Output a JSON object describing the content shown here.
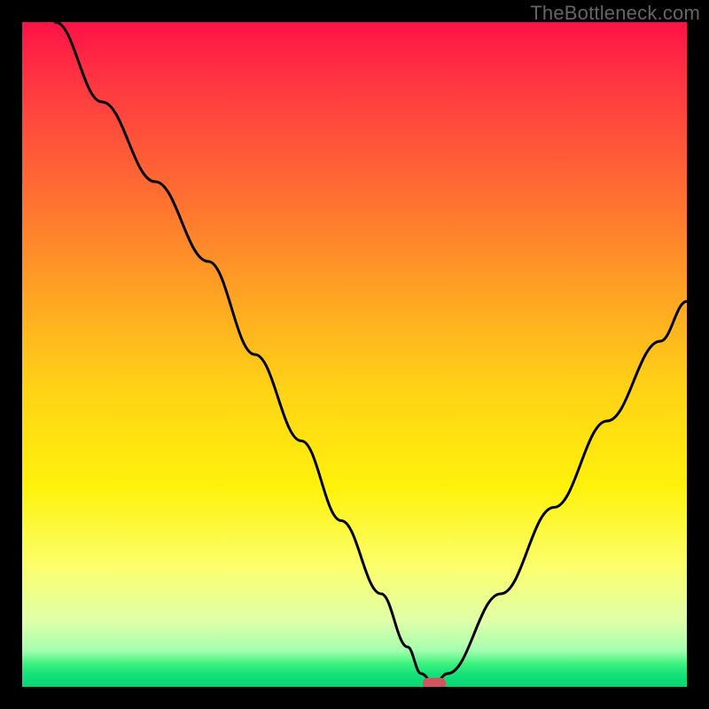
{
  "watermark": "TheBottleneck.com",
  "colors": {
    "gradient_stops": [
      {
        "offset": 0.0,
        "color": "#ff1246"
      },
      {
        "offset": 0.1,
        "color": "#ff3a41"
      },
      {
        "offset": 0.25,
        "color": "#ff6b32"
      },
      {
        "offset": 0.4,
        "color": "#ffa024"
      },
      {
        "offset": 0.55,
        "color": "#ffd216"
      },
      {
        "offset": 0.7,
        "color": "#fff20b"
      },
      {
        "offset": 0.82,
        "color": "#fbff6d"
      },
      {
        "offset": 0.9,
        "color": "#e0ffa8"
      },
      {
        "offset": 0.945,
        "color": "#a5ffb0"
      },
      {
        "offset": 0.965,
        "color": "#3ef37f"
      },
      {
        "offset": 0.98,
        "color": "#16e27a"
      },
      {
        "offset": 1.0,
        "color": "#05d572"
      }
    ],
    "curve": "#000000",
    "marker": "#d1555f",
    "frame": "#000000"
  },
  "chart_data": {
    "type": "line",
    "title": "",
    "xlabel": "",
    "ylabel": "",
    "xlim": [
      0,
      100
    ],
    "ylim": [
      0,
      100
    ],
    "series": [
      {
        "name": "bottleneck-curve",
        "x": [
          5,
          12,
          20,
          28,
          35,
          42,
          48,
          54,
          58,
          60,
          62,
          64,
          72,
          80,
          88,
          96,
          100
        ],
        "y": [
          100,
          88,
          76,
          64,
          50,
          37,
          25,
          14,
          6,
          2,
          0.5,
          2,
          14,
          27,
          40,
          52,
          58
        ]
      }
    ],
    "marker": {
      "x": 62,
      "y": 0.5
    }
  }
}
